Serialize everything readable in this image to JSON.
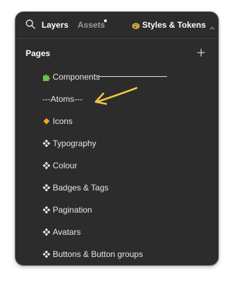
{
  "header": {
    "layers_tab": "Layers",
    "assets_tab": "Assets",
    "styles_button": "Styles & Tokens",
    "search_icon": "search-icon",
    "palette_icon": "palette-icon",
    "chevron_icon": "chevron-up-icon"
  },
  "pages": {
    "title": "Pages",
    "add_icon": "plus-icon",
    "items": [
      {
        "label": "Components",
        "icon": "puzzle-icon"
      },
      {
        "label": "---Atoms---",
        "icon": ""
      },
      {
        "label": "Icons",
        "icon": "orange-diamond-icon"
      },
      {
        "label": "Typography",
        "icon": "component-icon"
      },
      {
        "label": "Colour",
        "icon": "component-icon"
      },
      {
        "label": "Badges & Tags",
        "icon": "component-icon"
      },
      {
        "label": "Pagination",
        "icon": "component-icon"
      },
      {
        "label": "Avatars",
        "icon": "component-icon"
      },
      {
        "label": "Buttons & Button groups",
        "icon": "component-icon"
      }
    ]
  },
  "colors": {
    "panel_bg": "#2c2c2c",
    "text": "#e6e6e6",
    "muted": "#9a9a9a",
    "arrow": "#f2c544",
    "diamond": "#f5a623",
    "puzzle": "#6fbf4a"
  }
}
